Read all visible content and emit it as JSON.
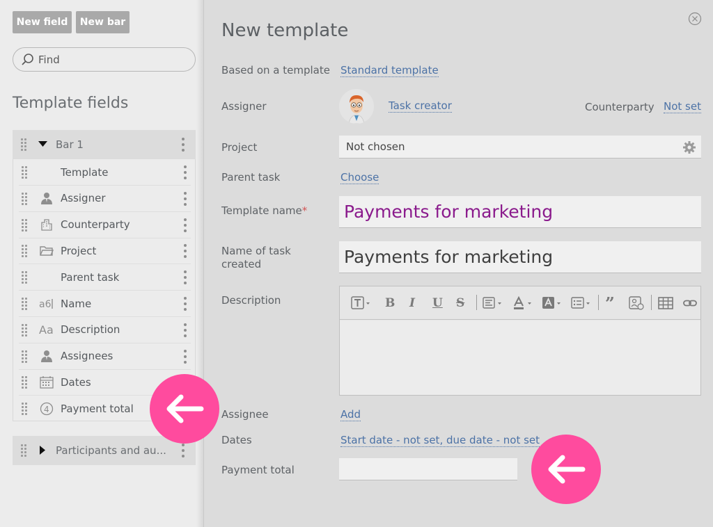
{
  "toolbar": {
    "new_field_label": "New field",
    "new_bar_label": "New bar"
  },
  "search": {
    "value": "Find"
  },
  "template_fields": {
    "title": "Template fields",
    "bar1_label": "Bar 1",
    "fields": [
      {
        "label": "Template",
        "icon": "none"
      },
      {
        "label": "Assigner",
        "icon": "person-icon"
      },
      {
        "label": "Counterparty",
        "icon": "building-icon"
      },
      {
        "label": "Project",
        "icon": "folder-icon"
      },
      {
        "label": "Parent task",
        "icon": "none"
      },
      {
        "label": "Name",
        "icon": "text-field-icon"
      },
      {
        "label": "Description",
        "icon": "text-aa-icon"
      },
      {
        "label": "Assignees",
        "icon": "person-icon"
      },
      {
        "label": "Dates",
        "icon": "calendar-icon"
      },
      {
        "label": "Payment total",
        "icon": "number-4-icon"
      }
    ],
    "bar2_label": "Participants and au..."
  },
  "modal": {
    "title": "New template",
    "based_on_label": "Based on a template",
    "based_on_value": "Standard template",
    "assigner_label": "Assigner",
    "assigner_value": "Task creator",
    "counterparty_label": "Counterparty",
    "counterparty_value": "Not set",
    "project_label": "Project",
    "project_value": "Not chosen",
    "parent_task_label": "Parent task",
    "parent_task_value": "Choose",
    "template_name_label": "Template name",
    "template_name_required": "*",
    "template_name_value": "Payments for marketing",
    "task_name_label_line1": "Name of task",
    "task_name_label_line2": "created",
    "task_name_value": "Payments for marketing",
    "description_label": "Description",
    "assignee_label": "Assignee",
    "assignee_value": "Add",
    "dates_label": "Dates",
    "dates_value": "Start date - not set, due date - not set",
    "payment_total_label": "Payment total",
    "payment_total_value": ""
  },
  "colors": {
    "link": "#4c72a6",
    "accent_purple": "#8a1a8c",
    "arrow_pink": "#ff4b9e",
    "button_gray": "#a9a9a9"
  }
}
